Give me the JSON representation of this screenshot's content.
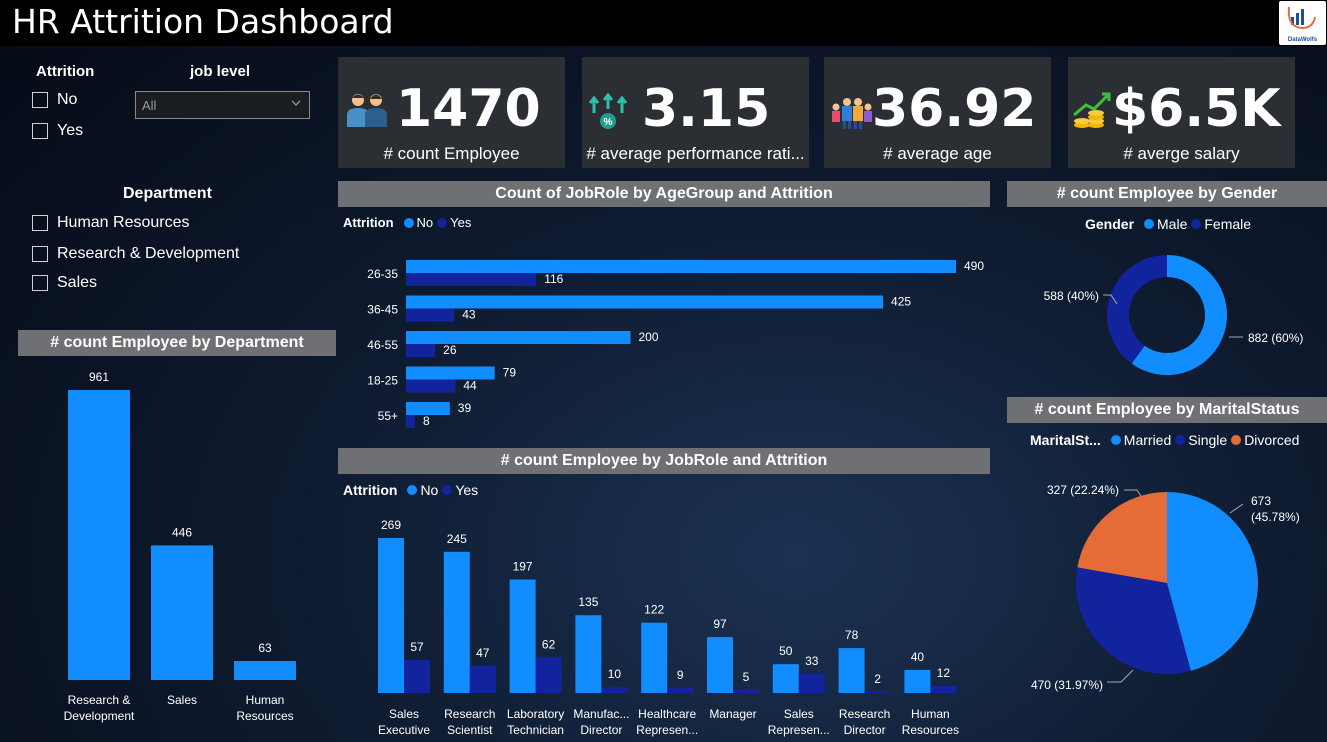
{
  "header": {
    "title": "HR Attrition Dashboard",
    "logo_text": "DataWolfs"
  },
  "colors": {
    "blue": "#118dff",
    "navy": "#12239e",
    "orange": "#e66c37",
    "card": "#2b2e33",
    "section": "#6f7073"
  },
  "filters": {
    "attrition": {
      "title": "Attrition",
      "options": [
        "No",
        "Yes"
      ]
    },
    "job_level": {
      "title": "job level",
      "value": "All"
    },
    "department": {
      "title": "Department",
      "options": [
        "Human Resources",
        "Research & Development",
        "Sales"
      ]
    }
  },
  "kpis": [
    {
      "value": "1470",
      "label": "# count Employee",
      "icon": "people-icon"
    },
    {
      "value": "3.15",
      "label": "# average performance rati...",
      "icon": "growth-arrows-icon"
    },
    {
      "value": "36.92",
      "label": "# average age",
      "icon": "family-icon"
    },
    {
      "value": "$6.5K",
      "label": "# averge salary",
      "icon": "coins-chart-icon"
    }
  ],
  "sections": {
    "dept": "# count Employee by Department",
    "age": "Count of JobRole by AgeGroup and Attrition",
    "gender": "# count Employee by Gender",
    "marital": "# count Employee by MaritalStatus",
    "jobrole": "# count Employee by JobRole and Attrition"
  },
  "legends": {
    "attrition_title": "Attrition",
    "no": "No",
    "yes": "Yes",
    "gender_title": "Gender",
    "male": "Male",
    "female": "Female",
    "marital_title": "MaritalSt...",
    "married": "Married",
    "single": "Single",
    "divorced": "Divorced"
  },
  "chart_data": [
    {
      "id": "dept",
      "type": "bar",
      "title": "# count Employee by Department",
      "categories": [
        "Research & Development",
        "Sales",
        "Human Resources"
      ],
      "category_labels": [
        [
          "Research &",
          "Development"
        ],
        [
          "Sales"
        ],
        [
          "Human",
          "Resources"
        ]
      ],
      "values": [
        961,
        446,
        63
      ],
      "ylim": [
        0,
        961
      ]
    },
    {
      "id": "age",
      "type": "bar",
      "orientation": "horizontal",
      "title": "Count of JobRole by AgeGroup and Attrition",
      "categories": [
        "26-35",
        "36-45",
        "46-55",
        "18-25",
        "55+"
      ],
      "series": [
        {
          "name": "No",
          "values": [
            490,
            425,
            200,
            79,
            39
          ]
        },
        {
          "name": "Yes",
          "values": [
            116,
            43,
            26,
            44,
            8
          ]
        }
      ],
      "xlim": [
        0,
        490
      ]
    },
    {
      "id": "gender",
      "type": "pie",
      "variant": "donut",
      "title": "# count Employee by Gender",
      "categories": [
        "Male",
        "Female"
      ],
      "values": [
        882,
        588
      ],
      "labels": [
        "882 (60%)",
        "588 (40%)"
      ]
    },
    {
      "id": "marital",
      "type": "pie",
      "title": "# count Employee by MaritalStatus",
      "categories": [
        "Married",
        "Single",
        "Divorced"
      ],
      "values": [
        673,
        470,
        327
      ],
      "labels": [
        [
          "673",
          "(45.78%)"
        ],
        [
          "470 (31.97%)"
        ],
        [
          "327 (22.24%)"
        ]
      ]
    },
    {
      "id": "jobrole",
      "type": "bar",
      "title": "# count Employee by JobRole and Attrition",
      "categories": [
        "Sales Executive",
        "Research Scientist",
        "Laboratory Technician",
        "Manufacturing Director",
        "Healthcare Representative",
        "Manager",
        "Sales Representative",
        "Research Director",
        "Human Resources"
      ],
      "category_labels": [
        [
          "Sales",
          "Executive"
        ],
        [
          "Research",
          "Scientist"
        ],
        [
          "Laboratory",
          "Technician"
        ],
        [
          "Manufac...",
          "Director"
        ],
        [
          "Healthcare",
          "Represen..."
        ],
        [
          "Manager"
        ],
        [
          "Sales",
          "Represen..."
        ],
        [
          "Research",
          "Director"
        ],
        [
          "Human",
          "Resources"
        ]
      ],
      "series": [
        {
          "name": "No",
          "values": [
            269,
            245,
            197,
            135,
            122,
            97,
            50,
            78,
            40
          ]
        },
        {
          "name": "Yes",
          "values": [
            57,
            47,
            62,
            10,
            9,
            5,
            33,
            2,
            12
          ]
        }
      ],
      "ylim": [
        0,
        269
      ]
    }
  ]
}
